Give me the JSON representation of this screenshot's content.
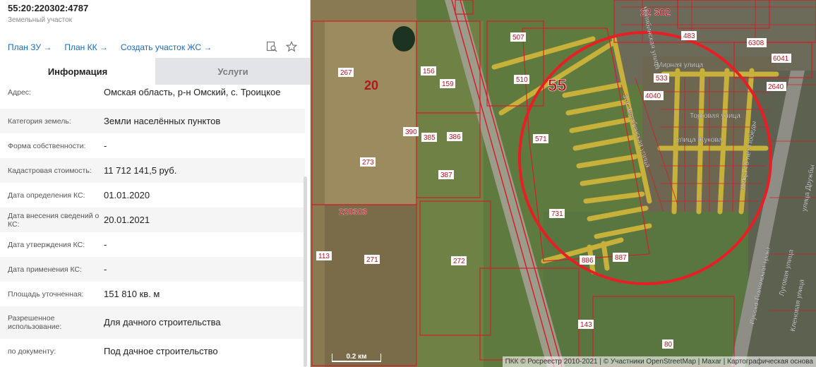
{
  "header": {
    "cadastral_number": "55:20:220302:4787",
    "object_type": "Земельный участок"
  },
  "links": [
    "План ЗУ →",
    "План КК →",
    "Создать участок ЖС →"
  ],
  "tabs": [
    {
      "label": "Информация",
      "active": true
    },
    {
      "label": "Услуги",
      "active": false
    }
  ],
  "info_rows": [
    {
      "label": "Адрес:",
      "value": "Омская область, р-н Омский, с. Троицкое"
    },
    {
      "label": "Категория земель:",
      "value": "Земли населённых пунктов"
    },
    {
      "label": "Форма собственности:",
      "value": "-"
    },
    {
      "label": "Кадастровая стоимость:",
      "value": "11 712 141,5 руб."
    },
    {
      "label": "Дата определения КС:",
      "value": "01.01.2020"
    },
    {
      "label": "Дата внесения сведений о КС:",
      "value": "20.01.2021"
    },
    {
      "label": "Дата утверждения КС:",
      "value": "-"
    },
    {
      "label": "Дата применения КС:",
      "value": "-"
    },
    {
      "label": "Площадь уточненная:",
      "value": "151 810 кв. м"
    },
    {
      "label": "Разрешенное использование:",
      "value": "Для дачного строительства"
    },
    {
      "label": "по документу:",
      "value": "Под дачное строительство"
    }
  ],
  "map": {
    "parcel_labels": [
      {
        "text": "507"
      },
      {
        "text": "510"
      },
      {
        "text": "571"
      },
      {
        "text": "731"
      },
      {
        "text": "886"
      },
      {
        "text": "887"
      },
      {
        "text": "143"
      },
      {
        "text": "80"
      },
      {
        "text": "267"
      },
      {
        "text": "156"
      },
      {
        "text": "159"
      },
      {
        "text": "390"
      },
      {
        "text": "385"
      },
      {
        "text": "386"
      },
      {
        "text": "273"
      },
      {
        "text": "387"
      },
      {
        "text": "271"
      },
      {
        "text": "272"
      },
      {
        "text": "113"
      },
      {
        "text": "483"
      },
      {
        "text": "6308"
      },
      {
        "text": "6041"
      },
      {
        "text": "2640"
      },
      {
        "text": "533"
      },
      {
        "text": "4040"
      }
    ],
    "quarter_labels": [
      "20",
      "55",
      "220303",
      "22 302"
    ],
    "streets": [
      "Мирная улица",
      "Торговая улица",
      "улица Жукова",
      "3-я Челябинская улица",
      "Челябинская улица",
      "улица 70 лет Победы",
      "Русско-Полянский тракт",
      "Кленовая улица",
      "Луговая улица",
      "улица Дружбы"
    ],
    "scale": "0.2 км",
    "attribution": "ПКК © Росреестр 2010-2021 | © Участники OpenStreetMap | Maxar | Картографическая основа"
  },
  "colors": {
    "parcel": "#d0202a",
    "circle": "#e81e25",
    "road": "#c8b13a",
    "link": "#1a6bb8"
  }
}
